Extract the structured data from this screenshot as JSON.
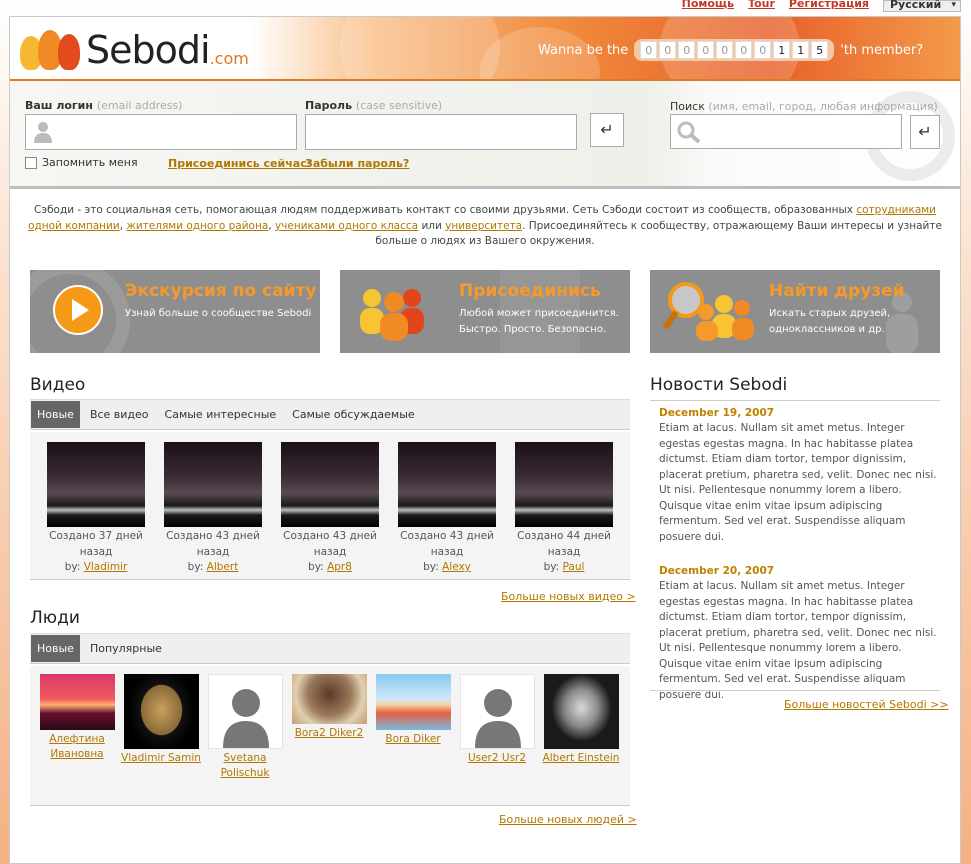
{
  "topnav": {
    "help": "Помощь",
    "tour": "Tour",
    "register": "Регистрация",
    "language": "Русский"
  },
  "header": {
    "logo_text": "Sebodi",
    "logo_suffix": ".com",
    "wanna_prefix": "Wanna be the",
    "wanna_suffix": "'th member?",
    "counter_digits": [
      "0",
      "0",
      "0",
      "0",
      "0",
      "0",
      "0",
      "1",
      "1",
      "5"
    ]
  },
  "login": {
    "login_label": "Ваш логин",
    "login_hint": "(email address)",
    "password_label": "Пароль",
    "password_hint": "(case sensitive)",
    "remember_label": "Запомнить меня",
    "join_link": "Присоединись сейчас!",
    "forgot_link": "Забыли пароль?",
    "search_label": "Поиск",
    "search_hint": "(имя, email, город, любая информация)"
  },
  "intro": {
    "p1": "Сэбоди - это социальная сеть, помогающая людям поддерживать контакт со своими друзьями. Сеть Сэбоди состоит из сообществ, образованных ",
    "l1": "сотрудниками одной компании",
    "s1": ", ",
    "l2": "жителями одного района",
    "s2": ", ",
    "l3": "учениками одного класса",
    "s3": " или ",
    "l4": "университета",
    "p2": ". Присоединяйтесь к сообществу, отражающему Ваши интересы и узнайте больше о людях из Вашего окружения."
  },
  "promos": [
    {
      "title": "Экскурсия по сайту",
      "desc1": "Узнай больше о сообществе Sebodi",
      "desc2": ""
    },
    {
      "title": "Присоединись",
      "desc1": "Любой может присоединится.",
      "desc2": "Быстро. Просто. Безопасно."
    },
    {
      "title": "Найти друзей",
      "desc1": "Искать старых друзей,",
      "desc2": "одноклассников и др."
    }
  ],
  "video": {
    "heading": "Видео",
    "tabs": [
      "Новые",
      "Все видео",
      "Самые интересные",
      "Самые обсуждаемые"
    ],
    "by_label": "by:",
    "items": [
      {
        "line1": "Создано 37 дней",
        "line2": "назад",
        "author": "Vladimir"
      },
      {
        "line1": "Создано 43 дней",
        "line2": "назад",
        "author": "Albert"
      },
      {
        "line1": "Создано 43 дней",
        "line2": "назад",
        "author": "Apr8"
      },
      {
        "line1": "Создано 43 дней",
        "line2": "назад",
        "author": "Alexy"
      },
      {
        "line1": "Создано 44 дней",
        "line2": "назад",
        "author": "Paul"
      }
    ],
    "more": "Больше новых видео >"
  },
  "people": {
    "heading": "Люди",
    "tabs": [
      "Новые",
      "Популярные"
    ],
    "items": [
      {
        "name1": "Алефтина",
        "name2": "Ивановна"
      },
      {
        "name1": "Vladimir Samin",
        "name2": ""
      },
      {
        "name1": "Svetana",
        "name2": "Polischuk"
      },
      {
        "name1": "Bora2 Diker2",
        "name2": ""
      },
      {
        "name1": "Bora Diker",
        "name2": ""
      },
      {
        "name1": "User2 Usr2",
        "name2": ""
      },
      {
        "name1": "Albert Einstein",
        "name2": ""
      }
    ],
    "more": "Больше новых людей >"
  },
  "news": {
    "heading": "Новости Sebodi",
    "items": [
      {
        "date": "December 19, 2007",
        "text": "Etiam at lacus. Nullam sit amet metus. Integer egestas egestas magna. In hac habitasse platea dictumst. Etiam diam tortor, tempor dignissim, placerat pretium, pharetra sed, velit. Donec nec nisi. Ut nisi. Pellentesque nonummy lorem a libero. Quisque vitae enim vitae ipsum adipiscing fermentum. Sed vel erat. Suspendisse aliquam posuere dui."
      },
      {
        "date": "December 20, 2007",
        "text": "Etiam at lacus. Nullam sit amet metus. Integer egestas egestas magna. In hac habitasse platea dictumst. Etiam diam tortor, tempor dignissim, placerat pretium, pharetra sed, velit. Donec nec nisi. Ut nisi. Pellentesque nonummy lorem a libero. Quisque vitae enim vitae ipsum adipiscing fermentum. Sed vel erat. Suspendisse aliquam posuere dui."
      }
    ],
    "more": "Больше новостей Sebodi >>"
  }
}
